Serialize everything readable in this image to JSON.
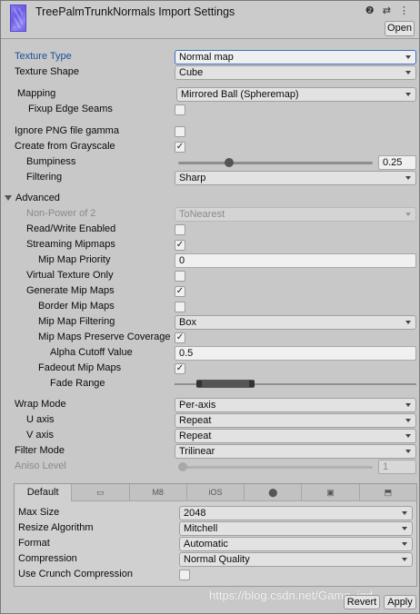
{
  "header": {
    "title": "TreePalmTrunkNormals Import Settings",
    "icons": "❷ ⇄ ⋮",
    "open_label": "Open"
  },
  "settings": {
    "texture_type": {
      "label": "Texture Type",
      "value": "Normal map"
    },
    "texture_shape": {
      "label": "Texture Shape",
      "value": "Cube"
    },
    "mapping": {
      "label": "Mapping",
      "value": "Mirrored Ball (Spheremap)"
    },
    "fixup_edge_seams": {
      "label": "Fixup Edge Seams",
      "checked": false
    },
    "ignore_png_gamma": {
      "label": "Ignore PNG file gamma",
      "checked": false
    },
    "create_from_grayscale": {
      "label": "Create from Grayscale",
      "checked": true
    },
    "bumpiness": {
      "label": "Bumpiness",
      "value": "0.25",
      "level": 0.25
    },
    "filtering": {
      "label": "Filtering",
      "value": "Sharp"
    }
  },
  "advanced": {
    "label": "Advanced",
    "non_power_of_2": {
      "label": "Non-Power of 2",
      "value": "ToNearest"
    },
    "read_write_enabled": {
      "label": "Read/Write Enabled",
      "checked": false
    },
    "streaming_mipmaps": {
      "label": "Streaming Mipmaps",
      "checked": true
    },
    "mip_map_priority": {
      "label": "Mip Map Priority",
      "value": "0"
    },
    "virtual_texture_only": {
      "label": "Virtual Texture Only",
      "checked": false
    },
    "generate_mip_maps": {
      "label": "Generate Mip Maps",
      "checked": true
    },
    "border_mip_maps": {
      "label": "Border Mip Maps",
      "checked": false
    },
    "mip_map_filtering": {
      "label": "Mip Map Filtering",
      "value": "Box"
    },
    "mip_maps_preserve_coverage": {
      "label": "Mip Maps Preserve Coverage",
      "checked": true
    },
    "alpha_cutoff_value": {
      "label": "Alpha Cutoff Value",
      "value": "0.5"
    },
    "fadeout_mip_maps": {
      "label": "Fadeout Mip Maps",
      "checked": true
    },
    "fade_range": {
      "label": "Fade Range"
    }
  },
  "wrap": {
    "wrap_mode": {
      "label": "Wrap Mode",
      "value": "Per-axis"
    },
    "u_axis": {
      "label": "U axis",
      "value": "Repeat"
    },
    "v_axis": {
      "label": "V axis",
      "value": "Repeat"
    },
    "filter_mode": {
      "label": "Filter Mode",
      "value": "Trilinear"
    },
    "aniso_level": {
      "label": "Aniso Level",
      "value": "1",
      "level": 0.0
    }
  },
  "platform_tabs": [
    "Default",
    "▭",
    "M8",
    "iOS",
    "⬤",
    "▣",
    "⬒"
  ],
  "platform": {
    "max_size": {
      "label": "Max Size",
      "value": "2048"
    },
    "resize_algorithm": {
      "label": "Resize Algorithm",
      "value": "Mitchell"
    },
    "format": {
      "label": "Format",
      "value": "Automatic"
    },
    "compression": {
      "label": "Compression",
      "value": "Normal Quality"
    },
    "use_crunch": {
      "label": "Use Crunch Compression",
      "checked": false
    }
  },
  "footer": {
    "watermark": "https://blog.csdn.net/Game_jqd",
    "revert_label": "Revert",
    "apply_label": "Apply"
  },
  "colors": {
    "accent": "#1b4f9a",
    "background": "#c8c8c8"
  }
}
